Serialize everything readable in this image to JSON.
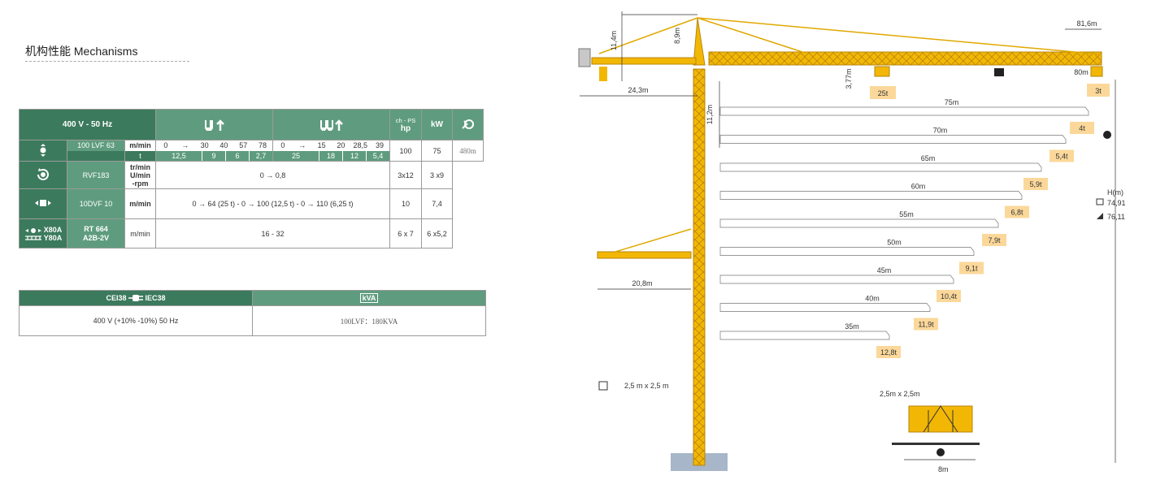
{
  "section_title": "机构性能 Mechanisms",
  "mech_table": {
    "header_power": "400 V - 50 Hz",
    "header_chps": "ch - PS",
    "header_hp": "hp",
    "header_kw": "kW",
    "rows": {
      "hoist": {
        "model": "100 LVF 63",
        "unit_speed": "m/min",
        "unit_load": "t",
        "speeds_a": [
          "0",
          "→",
          "30",
          "40",
          "57",
          "78"
        ],
        "loads_a": [
          "12,5",
          "9",
          "6",
          "2,7"
        ],
        "speeds_b": [
          "0",
          "→",
          "15",
          "20",
          "28,5",
          "39"
        ],
        "loads_b": [
          "25",
          "18",
          "12",
          "5,4"
        ],
        "hp": "100",
        "kw": "75",
        "rope": "480m"
      },
      "slewing": {
        "model": "RVF183",
        "unit_1": "tr/min",
        "unit_2": "U/min",
        "unit_3": "-rpm",
        "value": "0 → 0,8",
        "hp": "3x12",
        "kw": "3 x9"
      },
      "trolley": {
        "model": "10DVF 10",
        "unit": "m/min",
        "value": "0 → 64 (25 t) - 0 → 100 (12,5 t) - 0 → 110 (6,25 t)",
        "hp": "10",
        "kw": "7,4"
      },
      "climbing": {
        "code_1": "X80A",
        "code_2": "Y80A",
        "model_1": "RT 664",
        "model_2": "A2B-2V",
        "unit": "m/min",
        "value": "16 - 32",
        "hp": "6 x 7",
        "kw": "6 x5,2"
      }
    }
  },
  "power_table": {
    "header_left_a": "CEI38",
    "header_left_b": "IEC38",
    "header_right": "kVA",
    "value_left": "400 V (+10% -10%) 50 Hz",
    "value_right": "100LVF：180KVA"
  },
  "crane": {
    "dim_jib_total": "81,6m",
    "dim_counter_jib": "24,3m",
    "dim_mast_top": "11,4m",
    "dim_apex": "8,9m",
    "dim_hook_clear": "3,77m",
    "dim_tip": "80m",
    "dim_tower_section": "11,2m",
    "dim_lower_jib": "20,8m",
    "max_load": "25t",
    "tip_load": "3t",
    "load_curves": [
      {
        "radius": "75m",
        "load": "4t"
      },
      {
        "radius": "70m",
        "load": "5,4t"
      },
      {
        "radius": "65m",
        "load": "5,9t"
      },
      {
        "radius": "60m",
        "load": "6,8t"
      },
      {
        "radius": "55m",
        "load": "7,9t"
      },
      {
        "radius": "50m",
        "load": "9,1t"
      },
      {
        "radius": "45m",
        "load": "10,4t"
      },
      {
        "radius": "40m",
        "load": "11,9t"
      },
      {
        "radius": "35m",
        "load": "12,8t"
      }
    ],
    "height_label": "H(m)",
    "height_1": "74,91",
    "height_2": "76,11",
    "mast_section": "2,5 m x 2,5 m",
    "base_section": "2,5m x 2,5m",
    "base_width": "8m"
  },
  "colors": {
    "green_dark": "#3c7a5d",
    "green_light": "#5f9c7f",
    "crane_yellow": "#f2b705",
    "label_bg": "#fbd89a"
  }
}
